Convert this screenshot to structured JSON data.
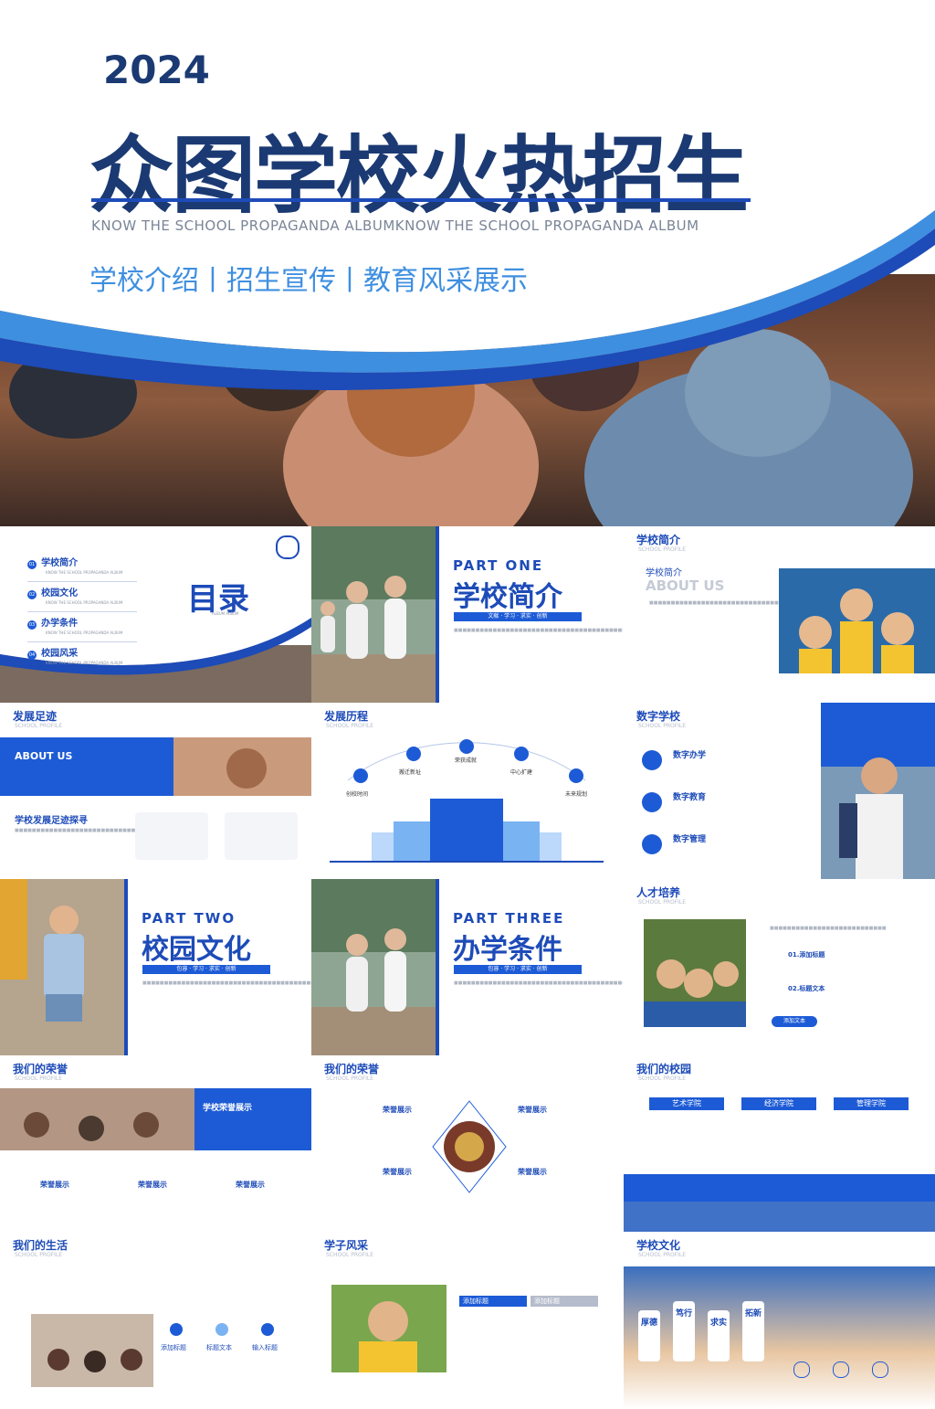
{
  "hero": {
    "year": "2024",
    "title": "众图学校火热招生",
    "english": "KNOW THE SCHOOL PROPAGANDA ALBUMKNOW THE SCHOOL PROPAGANDA ALBUM",
    "subtitle": "学校介绍丨招生宣传丨教育风采展示"
  },
  "toc": {
    "title": "目录",
    "sub": "ALBUM ALBUM",
    "items": [
      {
        "num": "01",
        "label": "学校简介",
        "en": "KNOW THE SCHOOL PROPAGANDA ALBUM"
      },
      {
        "num": "02",
        "label": "校园文化",
        "en": "KNOW THE SCHOOL PROPAGANDA ALBUM"
      },
      {
        "num": "03",
        "label": "办学条件",
        "en": "KNOW THE SCHOOL PROPAGANDA ALBUM"
      },
      {
        "num": "04",
        "label": "校园风采",
        "en": "KNOW THE SCHOOL PROPAGANDA ALBUM"
      }
    ]
  },
  "part_one": {
    "part": "PART ONE",
    "title": "学校简介",
    "tags": "文献 · 学习 · 求实 · 创新"
  },
  "school_intro": {
    "header": "学校简介",
    "header_sub": "SCHOOL PROFILE",
    "label": "学校简介",
    "about": "ABOUT US"
  },
  "development": {
    "header": "发展足迹",
    "header_sub": "SCHOOL PROFILE",
    "about": "ABOUT US",
    "subtitle": "学校发展足迹探寻"
  },
  "history": {
    "header": "发展历程",
    "header_sub": "SCHOOL PROFILE",
    "nodes": [
      "创校时间",
      "搬迁新址",
      "荣获成就",
      "中心扩建",
      "未来规划"
    ]
  },
  "digital": {
    "header": "数字学校",
    "header_sub": "SCHOOL PROFILE",
    "items": [
      "数字办学",
      "数字教育",
      "数字管理"
    ]
  },
  "part_two": {
    "part": "PART TWO",
    "title": "校园文化",
    "tags": "包容 · 学习 · 求实 · 创新"
  },
  "part_three": {
    "part": "PART THREE",
    "title": "办学条件",
    "tags": "包容 · 学习 · 求实 · 创新"
  },
  "talent": {
    "header": "人才培养",
    "header_sub": "SCHOOL PROFILE",
    "items": [
      "01.添加标题",
      "02.标题文本"
    ],
    "button": "添加文本"
  },
  "honor1": {
    "header": "我们的荣誉",
    "header_sub": "SCHOOL PROFILE",
    "banner": "学校荣誉展示",
    "items": [
      "荣誉展示",
      "荣誉展示",
      "荣誉展示"
    ]
  },
  "honor2": {
    "header": "我们的荣誉",
    "header_sub": "SCHOOL PROFILE",
    "items": [
      "荣誉展示",
      "荣誉展示",
      "荣誉展示",
      "荣誉展示"
    ]
  },
  "campus": {
    "header": "我们的校园",
    "header_sub": "SCHOOL PROFILE",
    "colleges": [
      "艺术学院",
      "经济学院",
      "管理学院"
    ]
  },
  "life": {
    "header": "我们的生活",
    "header_sub": "SCHOOL PROFILE",
    "items": [
      "添加标题",
      "标题文本",
      "输入标题"
    ]
  },
  "style": {
    "header": "学子风采",
    "header_sub": "SCHOOL PROFILE",
    "cards": [
      "添加标题",
      "添加标题"
    ]
  },
  "culture": {
    "header": "学校文化",
    "header_sub": "SCHOOL PROFILE",
    "words": [
      "厚德",
      "笃行",
      "求实",
      "拓新"
    ]
  },
  "colors": {
    "primary": "#1d4bb8",
    "accent": "#3f8fe0",
    "dark": "#1b3a73"
  }
}
